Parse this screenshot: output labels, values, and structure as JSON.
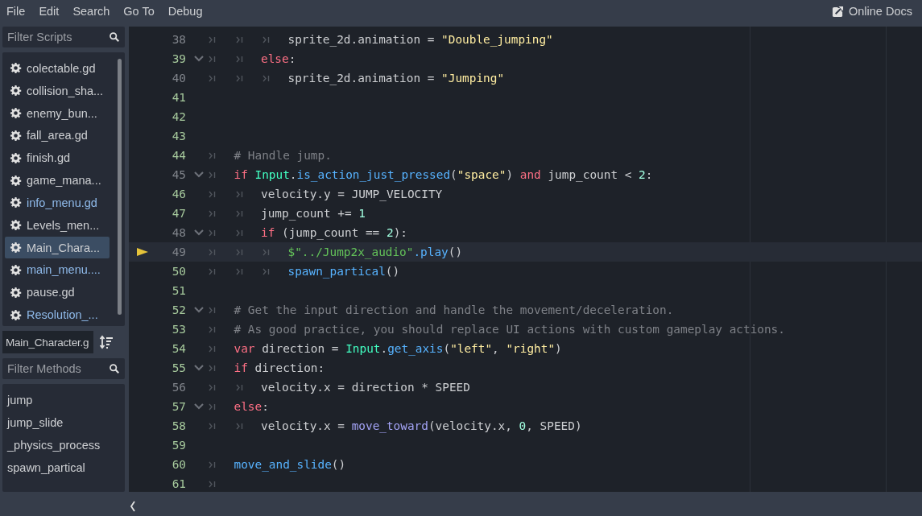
{
  "menu": [
    "File",
    "Edit",
    "Search",
    "Go To",
    "Debug"
  ],
  "online_docs": "Online Docs",
  "scripts": {
    "placeholder": "Filter Scripts",
    "items": [
      {
        "label": "colectable.gd",
        "selected": false,
        "color": "#cdcfd2"
      },
      {
        "label": "collision_sha...",
        "selected": false,
        "color": "#cdcfd2"
      },
      {
        "label": "enemy_bun...",
        "selected": false,
        "color": "#cdcfd2"
      },
      {
        "label": "fall_area.gd",
        "selected": false,
        "color": "#cdcfd2"
      },
      {
        "label": "finish.gd",
        "selected": false,
        "color": "#cdcfd2"
      },
      {
        "label": "game_mana...",
        "selected": false,
        "color": "#cdcfd2"
      },
      {
        "label": "info_menu.gd",
        "selected": false,
        "color": "#8fbaea"
      },
      {
        "label": "Levels_men...",
        "selected": false,
        "color": "#cdcfd2"
      },
      {
        "label": "Main_Chara...",
        "selected": true,
        "color": "#cdcfd2"
      },
      {
        "label": "main_menu....",
        "selected": false,
        "color": "#8fbaea"
      },
      {
        "label": "pause.gd",
        "selected": false,
        "color": "#cdcfd2"
      },
      {
        "label": "Resolution_...",
        "selected": false,
        "color": "#8fbaea"
      }
    ]
  },
  "current_script": "Main_Character.g",
  "methods": {
    "placeholder": "Filter Methods",
    "items": [
      "jump",
      "jump_slide",
      "_physics_process",
      "spawn_partical"
    ]
  },
  "code": [
    {
      "number": "38",
      "changed": false,
      "fold": false,
      "current": false,
      "tokens": [
        {
          "kind": "tab"
        },
        {
          "kind": "tab"
        },
        {
          "kind": "tab"
        },
        {
          "kind": "plain",
          "text": "sprite_2d.animation = "
        },
        {
          "kind": "string",
          "text": "\"Double_jumping\""
        }
      ]
    },
    {
      "number": "39",
      "changed": true,
      "fold": true,
      "current": false,
      "tokens": [
        {
          "kind": "tab"
        },
        {
          "kind": "tab"
        },
        {
          "kind": "keyword",
          "text": "else"
        },
        {
          "kind": "plain",
          "text": ":"
        }
      ]
    },
    {
      "number": "40",
      "changed": false,
      "fold": false,
      "current": false,
      "tokens": [
        {
          "kind": "tab"
        },
        {
          "kind": "tab"
        },
        {
          "kind": "tab"
        },
        {
          "kind": "plain",
          "text": "sprite_2d.animation = "
        },
        {
          "kind": "string",
          "text": "\"Jumping\""
        }
      ]
    },
    {
      "number": "41",
      "changed": true,
      "fold": false,
      "current": false
    },
    {
      "number": "42",
      "changed": true,
      "fold": false,
      "current": false
    },
    {
      "number": "43",
      "changed": true,
      "fold": false,
      "current": false
    },
    {
      "number": "44",
      "changed": true,
      "fold": false,
      "current": false,
      "tokens": [
        {
          "kind": "tab"
        },
        {
          "kind": "comment",
          "text": "# Handle jump."
        }
      ]
    },
    {
      "number": "45",
      "changed": false,
      "fold": true,
      "current": false,
      "tokens": [
        {
          "kind": "tab"
        },
        {
          "kind": "keyword",
          "text": "if"
        },
        {
          "kind": "class",
          "text": " Input"
        },
        {
          "kind": "plain",
          "text": "."
        },
        {
          "kind": "func",
          "text": "is_action_just_pressed"
        },
        {
          "kind": "plain",
          "text": "("
        },
        {
          "kind": "string",
          "text": "\"space\""
        },
        {
          "kind": "plain",
          "text": ") "
        },
        {
          "kind": "keyword",
          "text": "and"
        },
        {
          "kind": "plain",
          "text": " jump_count < "
        },
        {
          "kind": "number",
          "text": "2"
        },
        {
          "kind": "plain",
          "text": ":"
        }
      ]
    },
    {
      "number": "46",
      "changed": true,
      "fold": false,
      "current": false,
      "tokens": [
        {
          "kind": "tab"
        },
        {
          "kind": "tab"
        },
        {
          "kind": "plain",
          "text": "velocity.y = JUMP_VELOCITY"
        }
      ]
    },
    {
      "number": "47",
      "changed": true,
      "fold": false,
      "current": false,
      "tokens": [
        {
          "kind": "tab"
        },
        {
          "kind": "tab"
        },
        {
          "kind": "plain",
          "text": "jump_count += "
        },
        {
          "kind": "number",
          "text": "1"
        }
      ]
    },
    {
      "number": "48",
      "changed": false,
      "fold": true,
      "current": false,
      "tokens": [
        {
          "kind": "tab"
        },
        {
          "kind": "tab"
        },
        {
          "kind": "keyword",
          "text": "if"
        },
        {
          "kind": "plain",
          "text": " (jump_count == "
        },
        {
          "kind": "number",
          "text": "2"
        },
        {
          "kind": "plain",
          "text": "):"
        }
      ]
    },
    {
      "number": "49",
      "changed": false,
      "fold": false,
      "current": true,
      "tokens": [
        {
          "kind": "tab"
        },
        {
          "kind": "tab"
        },
        {
          "kind": "tab"
        },
        {
          "kind": "nodepath",
          "text": "$\"../Jump2x_audio\""
        },
        {
          "kind": "func",
          "text": ".play"
        },
        {
          "kind": "plain",
          "text": "()"
        }
      ]
    },
    {
      "number": "50",
      "changed": true,
      "fold": false,
      "current": false,
      "tokens": [
        {
          "kind": "tab"
        },
        {
          "kind": "tab"
        },
        {
          "kind": "tab"
        },
        {
          "kind": "func",
          "text": "spawn_partical"
        },
        {
          "kind": "plain",
          "text": "()"
        }
      ]
    },
    {
      "number": "51",
      "changed": true,
      "fold": false,
      "current": false
    },
    {
      "number": "52",
      "changed": true,
      "fold": true,
      "current": false,
      "tokens": [
        {
          "kind": "tab"
        },
        {
          "kind": "comment",
          "text": "# Get the input direction and handle the movement/deceleration."
        }
      ]
    },
    {
      "number": "53",
      "changed": true,
      "fold": false,
      "current": false,
      "tokens": [
        {
          "kind": "tab"
        },
        {
          "kind": "comment",
          "text": "# As good practice, you should replace UI actions with custom gameplay actions."
        }
      ]
    },
    {
      "number": "54",
      "changed": true,
      "fold": false,
      "current": false,
      "tokens": [
        {
          "kind": "tab"
        },
        {
          "kind": "keyword2",
          "text": "var"
        },
        {
          "kind": "plain",
          "text": " direction = "
        },
        {
          "kind": "class",
          "text": "Input"
        },
        {
          "kind": "plain",
          "text": "."
        },
        {
          "kind": "func",
          "text": "get_axis"
        },
        {
          "kind": "plain",
          "text": "("
        },
        {
          "kind": "string",
          "text": "\"left\""
        },
        {
          "kind": "plain",
          "text": ", "
        },
        {
          "kind": "string",
          "text": "\"right\""
        },
        {
          "kind": "plain",
          "text": ")"
        }
      ]
    },
    {
      "number": "55",
      "changed": true,
      "fold": true,
      "current": false,
      "tokens": [
        {
          "kind": "tab"
        },
        {
          "kind": "keyword",
          "text": "if"
        },
        {
          "kind": "plain",
          "text": " direction:"
        }
      ]
    },
    {
      "number": "56",
      "changed": false,
      "fold": false,
      "current": false,
      "tokens": [
        {
          "kind": "tab"
        },
        {
          "kind": "tab"
        },
        {
          "kind": "plain",
          "text": "velocity.x = direction * SPEED"
        }
      ]
    },
    {
      "number": "57",
      "changed": true,
      "fold": true,
      "current": false,
      "tokens": [
        {
          "kind": "tab"
        },
        {
          "kind": "keyword",
          "text": "else"
        },
        {
          "kind": "plain",
          "text": ":"
        }
      ]
    },
    {
      "number": "58",
      "changed": true,
      "fold": false,
      "current": false,
      "tokens": [
        {
          "kind": "tab"
        },
        {
          "kind": "tab"
        },
        {
          "kind": "plain",
          "text": "velocity.x = "
        },
        {
          "kind": "builtin",
          "text": "move_toward"
        },
        {
          "kind": "plain",
          "text": "(velocity.x, "
        },
        {
          "kind": "number",
          "text": "0"
        },
        {
          "kind": "plain",
          "text": ", SPEED)"
        }
      ]
    },
    {
      "number": "59",
      "changed": true,
      "fold": false,
      "current": false
    },
    {
      "number": "60",
      "changed": true,
      "fold": false,
      "current": false,
      "tokens": [
        {
          "kind": "tab"
        },
        {
          "kind": "func",
          "text": "move_and_slide"
        },
        {
          "kind": "plain",
          "text": "()"
        }
      ]
    },
    {
      "number": "61",
      "changed": true,
      "fold": false,
      "current": false,
      "tokens": [
        {
          "kind": "tab"
        }
      ]
    }
  ]
}
